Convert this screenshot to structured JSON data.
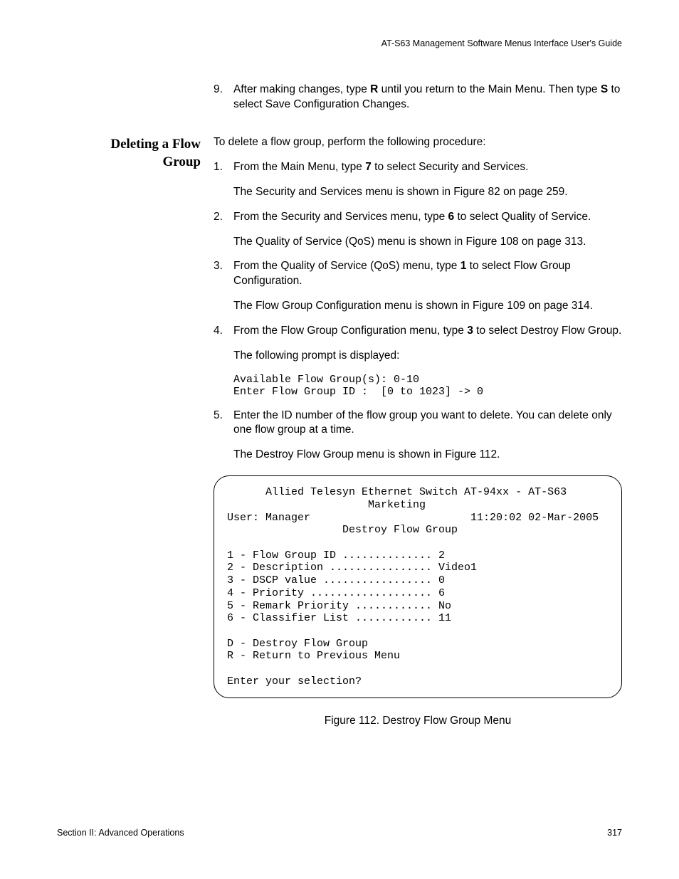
{
  "header": "AT-S63 Management Software Menus Interface User's Guide",
  "prior_step": {
    "num": "9.",
    "text_before": "After making changes, type ",
    "bold1": "R",
    "text_mid": " until you return to the Main Menu. Then type ",
    "bold2": "S",
    "text_after": " to select Save Configuration Changes."
  },
  "side_heading_line1": "Deleting a Flow",
  "side_heading_line2": "Group",
  "intro": "To delete a flow group, perform the following procedure:",
  "steps": [
    {
      "num": "1.",
      "pre": "From the Main Menu, type ",
      "bold": "7",
      "post": " to select Security and Services.",
      "sub": "The Security and Services menu is shown in Figure 82 on page 259."
    },
    {
      "num": "2.",
      "pre": "From the Security and Services menu, type ",
      "bold": "6",
      "post": " to select Quality of Service.",
      "sub": "The Quality of Service (QoS) menu is shown in Figure 108 on page 313."
    },
    {
      "num": "3.",
      "pre": "From the Quality of Service (QoS) menu, type ",
      "bold": "1",
      "post": " to select Flow Group Configuration.",
      "sub": "The Flow Group Configuration menu is shown in Figure 109 on page 314."
    },
    {
      "num": "4.",
      "pre": "From the Flow Group Configuration menu, type ",
      "bold": "3",
      "post": " to select Destroy Flow Group.",
      "sub": "The following prompt is displayed:",
      "mono": "Available Flow Group(s): 0-10\nEnter Flow Group ID :  [0 to 1023] -> 0"
    },
    {
      "num": "5.",
      "plain": "Enter the ID number of the flow group you want to delete. You can delete only one flow group at a time.",
      "sub": "The Destroy Flow Group menu is shown in Figure 112."
    }
  ],
  "terminal": "      Allied Telesyn Ethernet Switch AT-94xx - AT-S63\n                      Marketing\nUser: Manager                         11:20:02 02-Mar-2005\n                  Destroy Flow Group\n\n1 - Flow Group ID .............. 2\n2 - Description ................ Video1\n3 - DSCP value ................. 0\n4 - Priority ................... 6\n5 - Remark Priority ............ No\n6 - Classifier List ............ 11\n\nD - Destroy Flow Group\nR - Return to Previous Menu\n\nEnter your selection?",
  "figure_caption": "Figure 112. Destroy Flow Group Menu",
  "footer_left": "Section II: Advanced Operations",
  "footer_right": "317"
}
